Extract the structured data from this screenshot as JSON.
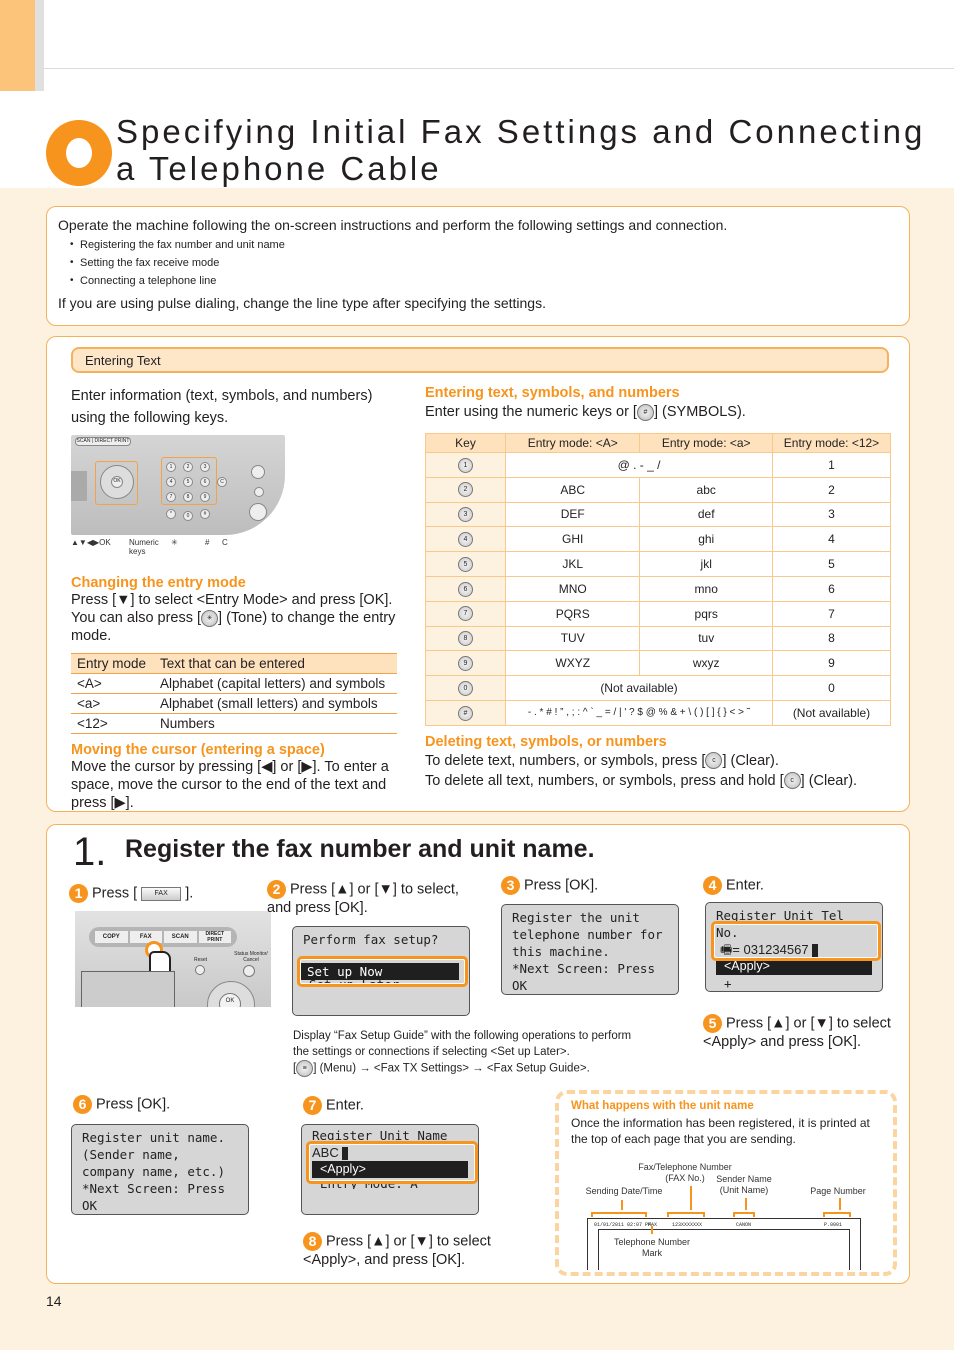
{
  "page": {
    "title_line1": "Specifying Initial Fax Settings and Connecting",
    "title_line2": "a Telephone Cable",
    "page_number": "14",
    "accent_color": "#f7941d"
  },
  "intro": {
    "lead": "Operate the machine following the on-screen instructions and perform the following settings and connection.",
    "bullets": [
      "Registering the fax number and unit name",
      "Setting the fax receive mode",
      "Connecting a telephone line"
    ],
    "foot": "If you are using pulse dialing, change the line type after specifying the settings."
  },
  "entering_text": {
    "header": "Entering Text",
    "intro": "Enter information (text, symbols, and numbers) using the following keys.",
    "key_labels": {
      "nav": "▲▼◀▶OK",
      "numeric": "Numeric keys",
      "tone": "✳",
      "hash": "#",
      "clear": "C"
    },
    "changing_mode": {
      "heading": "Changing the entry mode",
      "text1": "Press [",
      "text2": "] to select <Entry Mode> and press [OK]. You can also press [",
      "text3": "] (Tone) to change the entry mode."
    },
    "mode_table": {
      "headers": [
        "Entry mode",
        "Text that can be entered"
      ],
      "rows": [
        [
          "<A>",
          "Alphabet (capital letters) and symbols"
        ],
        [
          "<a>",
          "Alphabet (small letters) and symbols"
        ],
        [
          "<12>",
          "Numbers"
        ]
      ]
    },
    "moving_cursor": {
      "heading": "Moving the cursor (entering a space)",
      "text1": "Move the cursor by pressing [",
      "text2": "] or [",
      "text3": "]. To enter a space, move the cursor to the end of the text and press [",
      "text4": "]."
    },
    "symbols": {
      "heading": "Entering text, symbols, and numbers",
      "text1": "Enter using the numeric keys or [",
      "text2": "] (SYMBOLS)."
    },
    "key_table": {
      "headers": [
        "Key",
        "Entry mode: <A>",
        "Entry mode: <a>",
        "Entry mode: <12>"
      ],
      "rows": [
        {
          "key": "1",
          "A": "@ . - _ /",
          "a": null,
          "n": "1",
          "merged": true
        },
        {
          "key": "2",
          "A": "ABC",
          "a": "abc",
          "n": "2"
        },
        {
          "key": "3",
          "A": "DEF",
          "a": "def",
          "n": "3"
        },
        {
          "key": "4",
          "A": "GHI",
          "a": "ghi",
          "n": "4"
        },
        {
          "key": "5",
          "A": "JKL",
          "a": "jkl",
          "n": "5"
        },
        {
          "key": "6",
          "A": "MNO",
          "a": "mno",
          "n": "6"
        },
        {
          "key": "7",
          "A": "PQRS",
          "a": "pqrs",
          "n": "7"
        },
        {
          "key": "8",
          "A": "TUV",
          "a": "tuv",
          "n": "8"
        },
        {
          "key": "9",
          "A": "WXYZ",
          "a": "wxyz",
          "n": "9"
        },
        {
          "key": "0",
          "A": "(Not available)",
          "a": null,
          "n": "0",
          "merged": true
        },
        {
          "key": "#",
          "A": "- . * # ! ” , ; : ^ ` _ = / | ' ? $ @ % & + \\ ( ) [ ] { } < > ˜",
          "a": null,
          "n": "(Not available)",
          "merged": true
        }
      ]
    },
    "deleting": {
      "heading": "Deleting text, symbols, or numbers",
      "line1a": "To delete text, numbers, or symbols, press [",
      "line1b": "] (Clear).",
      "line2a": "To delete all text, numbers, or symbols, press and hold [",
      "line2b": "] (Clear)."
    }
  },
  "section1": {
    "number": "1.",
    "title": "Register the fax number and unit name.",
    "steps": {
      "s1": {
        "num": "1",
        "text_a": "Press [",
        "button": "FAX",
        "text_b": "]."
      },
      "s2": {
        "num": "2",
        "text_a": "Press [",
        "text_b": "] or [",
        "text_c": "] to select, and press [OK]."
      },
      "s3": {
        "num": "3",
        "text": "Press [OK]."
      },
      "s4": {
        "num": "4",
        "text": "Enter."
      },
      "s5": {
        "num": "5",
        "text_a": "Press [",
        "text_b": "] or [",
        "text_c": "] to select <Apply> and press [OK]."
      },
      "s6": {
        "num": "6",
        "text": "Press [OK]."
      },
      "s7": {
        "num": "7",
        "text": "Enter."
      },
      "s8": {
        "num": "8",
        "text_a": "Press [",
        "text_b": "] or [",
        "text_c": "] to select <Apply>, and press [OK]."
      }
    },
    "panel_buttons": [
      "COPY",
      "FAX",
      "SCAN",
      "DIRECT PRINT"
    ],
    "panel_labels": {
      "reset": "Reset",
      "status": "Status Monitor/ Cancel",
      "ok": "OK"
    },
    "lcd2": {
      "title": "Perform fax setup?",
      "selected": "Set up Now",
      "next": "Set up Later"
    },
    "lcd3": {
      "lines": [
        "Register the unit",
        "telephone number for",
        "this machine.",
        "*Next Screen: Press OK"
      ]
    },
    "lcd4": {
      "title": "Register Unit Tel No.",
      "value": "= 031234567",
      "selected": "<Apply>",
      "extra": "+"
    },
    "lcd6": {
      "lines": [
        "Register unit name.",
        "(Sender name,",
        "company name, etc.)",
        "*Next Screen: Press OK"
      ]
    },
    "lcd7": {
      "title": "Register Unit Name",
      "value": "ABC",
      "selected": "<Apply>",
      "extra": "Entry Mode: A"
    },
    "note": {
      "line1": "Display “Fax Setup Guide” with the following operations to perform the settings or connections if selecting <Set up Later>.",
      "line2a": "[",
      "line2b": "] (Menu) → <Fax TX Settings> → <Fax Setup Guide>."
    },
    "unit_name_box": {
      "heading": "What happens with the unit name",
      "text": "Once the information has been registered, it is printed at the top of each page that you are sending.",
      "labels": {
        "date": "Sending Date/Time",
        "fax": "Fax/Telephone Number (FAX No.)",
        "sender": "Sender Name (Unit Name)",
        "page": "Page Number",
        "tel": "Telephone Number Mark"
      },
      "strip": {
        "date": "01/01/2011 02:07 PM",
        "mark": "FAX",
        "fax": "123XXXXXXX",
        "sender": "CANON",
        "page": "P.0001"
      }
    }
  }
}
